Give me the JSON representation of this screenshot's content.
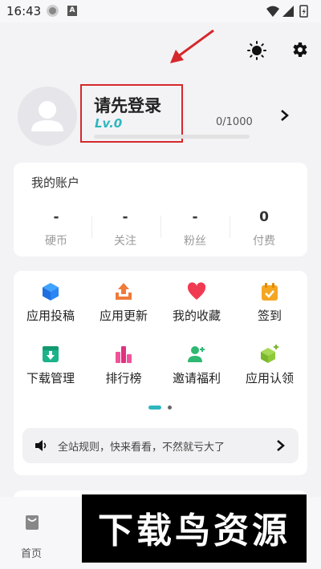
{
  "status_bar": {
    "time": "16:43",
    "icons": [
      "app-notification-icon",
      "a-notification-icon",
      "wifi-icon",
      "signal-icon",
      "battery-icon"
    ]
  },
  "header": {
    "icons": [
      "theme-sun-icon",
      "settings-gear-icon"
    ]
  },
  "profile": {
    "login_prompt": "请先登录",
    "level": "Lv.0",
    "experience": "0/1000",
    "experience_progress": 0
  },
  "account": {
    "title": "我的账户",
    "stats": [
      {
        "value": "-",
        "label": "硬币"
      },
      {
        "value": "-",
        "label": "关注"
      },
      {
        "value": "-",
        "label": "粉丝"
      },
      {
        "value": "0",
        "label": "付费"
      }
    ]
  },
  "features": {
    "items": [
      {
        "label": "应用投稿",
        "icon": "cube-icon"
      },
      {
        "label": "应用更新",
        "icon": "upload-icon"
      },
      {
        "label": "我的收藏",
        "icon": "heart-icon"
      },
      {
        "label": "签到",
        "icon": "calendar-check-icon"
      },
      {
        "label": "下载管理",
        "icon": "download-box-icon"
      },
      {
        "label": "排行榜",
        "icon": "bar-chart-icon"
      },
      {
        "label": "邀请福利",
        "icon": "add-user-icon"
      },
      {
        "label": "应用认领",
        "icon": "cube-plus-icon"
      }
    ],
    "page_indicator": {
      "active": 1,
      "total": 2
    }
  },
  "notice": {
    "text": "全站规则，快来看看，不然就亏大了"
  },
  "bottom_nav": {
    "home_label": "首页"
  },
  "watermark": {
    "text": "下载鸟资源"
  },
  "colors": {
    "accent": "#2fb6bd",
    "annotation_red": "#d5282b",
    "background": "#f3f3f5",
    "card": "#ffffff"
  }
}
